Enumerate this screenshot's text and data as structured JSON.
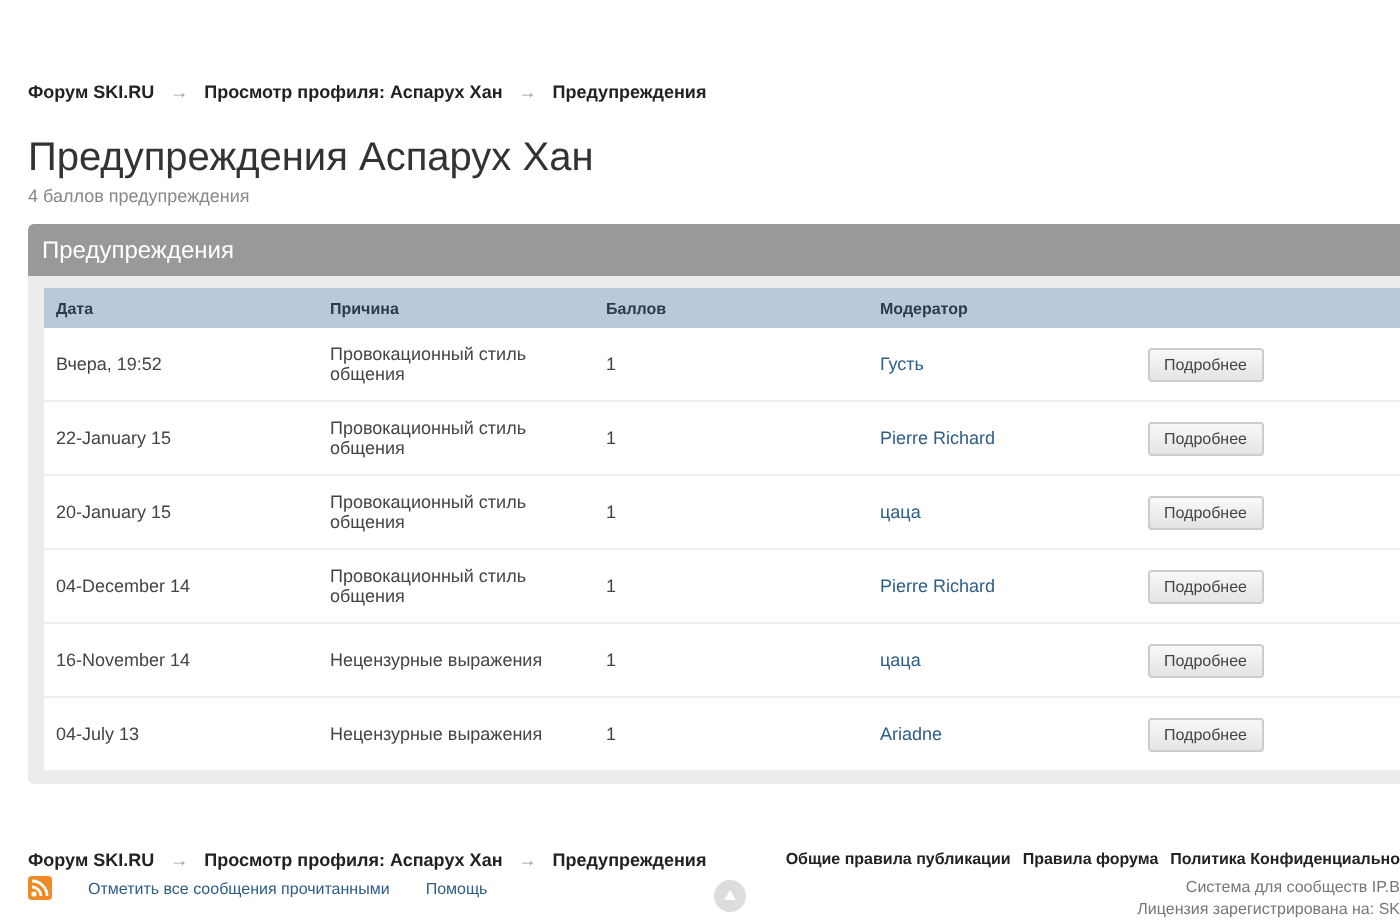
{
  "breadcrumbs": [
    "Форум SKI.RU",
    "Просмотр профиля: Аспарух Хан",
    "Предупреждения"
  ],
  "breadcrumb_separator": "→",
  "title": "Предупреждения Аспарух Хан",
  "subtitle": "4 баллов предупреждения",
  "panel": {
    "title": "Предупреждения",
    "columns": [
      "Дата",
      "Причина",
      "Баллов",
      "Модератор"
    ],
    "rows": [
      {
        "date": "Вчера, 19:52",
        "reason": "Провокационный стиль общения",
        "points": "1",
        "moderator": "Густь",
        "button": "Подробнее"
      },
      {
        "date": "22-January 15",
        "reason": "Провокационный стиль общения",
        "points": "1",
        "moderator": "Pierre Richard",
        "button": "Подробнее"
      },
      {
        "date": "20-January 15",
        "reason": "Провокационный стиль общения",
        "points": "1",
        "moderator": "цаца",
        "button": "Подробнее"
      },
      {
        "date": "04-December 14",
        "reason": "Провокационный стиль общения",
        "points": "1",
        "moderator": "Pierre Richard",
        "button": "Подробнее"
      },
      {
        "date": "16-November 14",
        "reason": "Нецензурные выражения",
        "points": "1",
        "moderator": "цаца",
        "button": "Подробнее"
      },
      {
        "date": "04-July 13",
        "reason": "Нецензурные выражения",
        "points": "1",
        "moderator": "Ariadne",
        "button": "Подробнее"
      }
    ]
  },
  "footer": {
    "breadcrumbs": [
      "Форум SKI.RU",
      "Просмотр профиля: Аспарух Хан",
      "Предупреждения"
    ],
    "links": [
      "Общие правила публикации",
      "Правила форума",
      "Политика Конфиденциально"
    ],
    "bottom_links": [
      "Отметить все сообщения прочитанными",
      "Помощь"
    ],
    "system_lines": [
      "Система для сообществ IP.B",
      "Лицензия зарегистрирована на: SK"
    ]
  }
}
